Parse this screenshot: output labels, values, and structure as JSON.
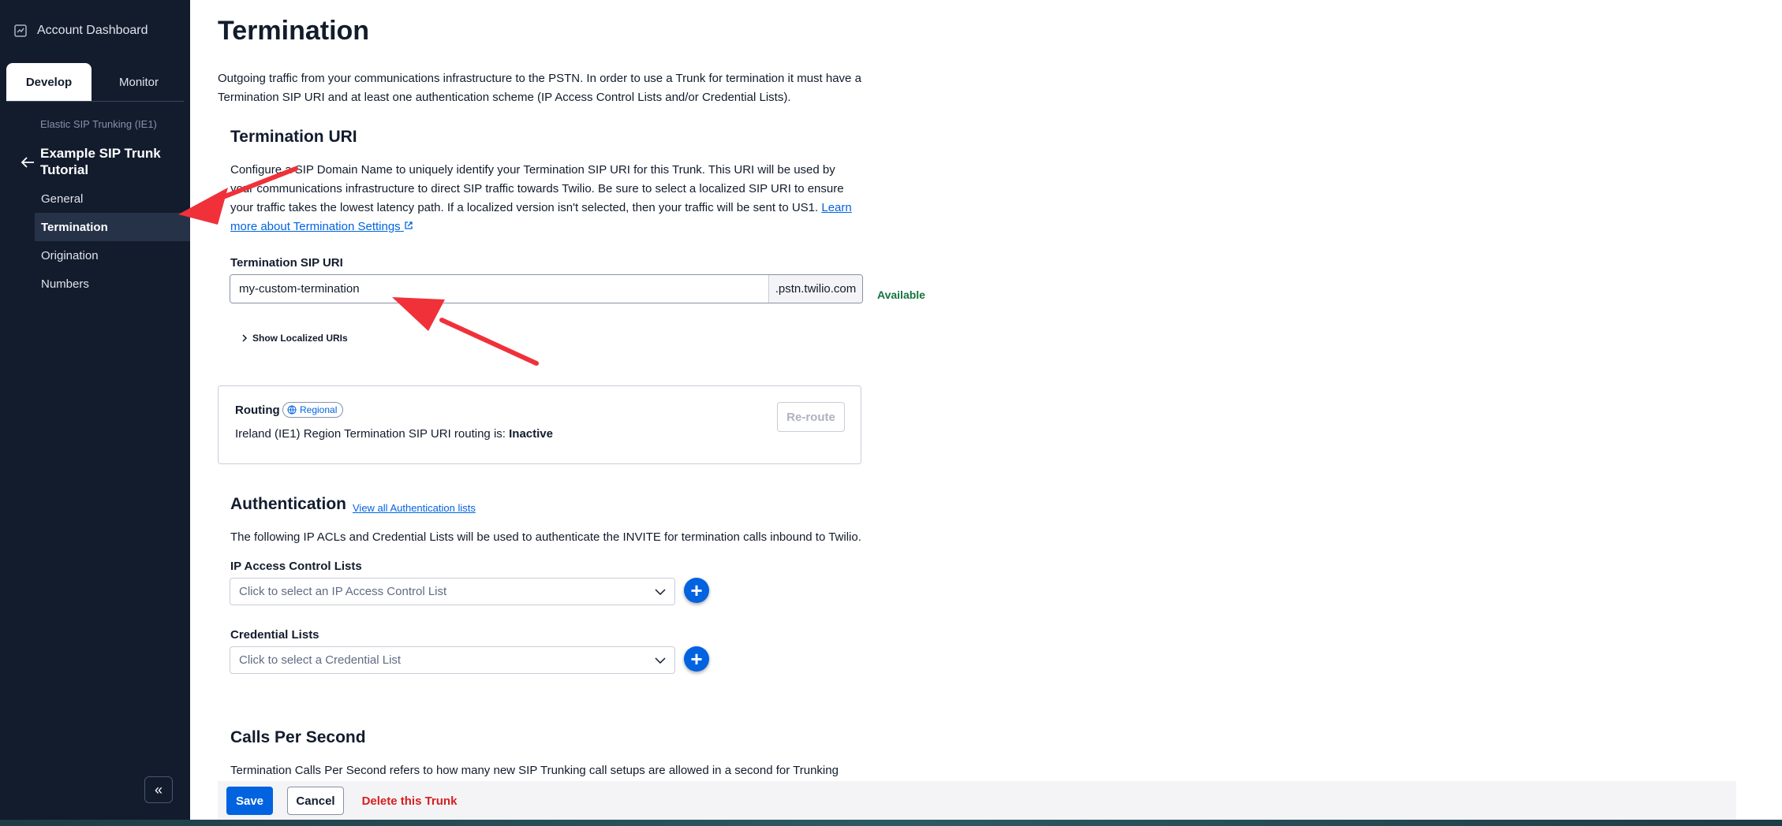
{
  "sidebar": {
    "account_dashboard": "Account Dashboard",
    "tabs": [
      {
        "label": "Develop"
      },
      {
        "label": "Monitor"
      }
    ],
    "breadcrumb": "Elastic SIP Trunking (IE1)",
    "trunk_name": "Example SIP Trunk Tutorial",
    "nav": [
      {
        "label": "General"
      },
      {
        "label": "Termination",
        "active": true
      },
      {
        "label": "Origination"
      },
      {
        "label": "Numbers"
      }
    ],
    "collapse_icon": "chevrons-left-icon"
  },
  "page": {
    "title": "Termination",
    "intro": "Outgoing traffic from your communications infrastructure to the PSTN. In order to use a Trunk for termination it must have a Termination SIP URI and at least one authentication scheme (IP Access Control Lists and/or Credential Lists)."
  },
  "termination_uri": {
    "heading": "Termination URI",
    "description": "Configure a SIP Domain Name to uniquely identify your Termination SIP URI for this Trunk. This URI will be used by your communications infrastructure to direct SIP traffic towards Twilio. Be sure to select a localized SIP URI to ensure your traffic takes the lowest latency path. If a localized version isn't selected, then your traffic will be sent to US1.",
    "learn_more_link": "Learn more about Termination Settings",
    "field_label": "Termination SIP URI",
    "field_value": "my-custom-termination",
    "field_suffix": ".pstn.twilio.com",
    "availability": "Available",
    "show_localized": "Show Localized URIs"
  },
  "routing": {
    "label": "Routing",
    "badge": "Regional",
    "status_prefix": "Ireland (IE1) Region Termination SIP URI routing is:",
    "status_value": "Inactive",
    "reroute_button": "Re-route"
  },
  "authentication": {
    "heading": "Authentication",
    "view_all_link": "View all Authentication lists",
    "description": "The following IP ACLs and Credential Lists will be used to authenticate the INVITE for termination calls inbound to Twilio.",
    "ip_acl_label": "IP Access Control Lists",
    "ip_acl_placeholder": "Click to select an IP Access Control List",
    "cred_label": "Credential Lists",
    "cred_placeholder": "Click to select a Credential List"
  },
  "cps": {
    "heading": "Calls Per Second",
    "description": "Termination Calls Per Second refers to how many new SIP Trunking call setups are allowed in a second for Trunking"
  },
  "footer": {
    "save": "Save",
    "cancel": "Cancel",
    "delete": "Delete this Trunk"
  },
  "colors": {
    "sidebar_bg": "#121c2d",
    "primary_blue": "#0263e0",
    "success_green": "#14743d",
    "danger_red": "#d61f1f",
    "annotation_arrow": "#f0313a"
  }
}
